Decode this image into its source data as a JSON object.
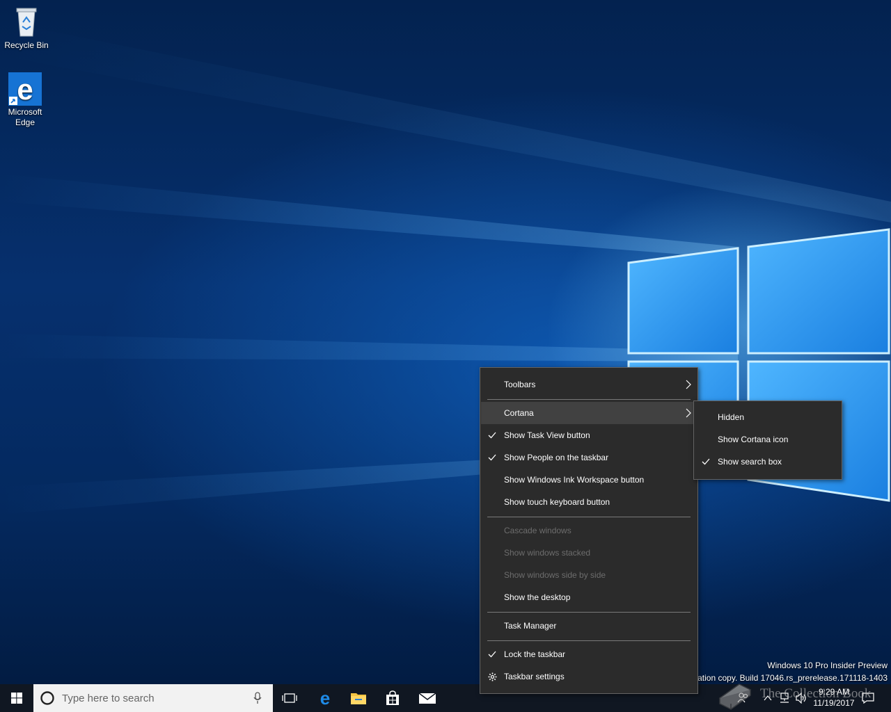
{
  "desktop": {
    "icons": [
      {
        "label": "Recycle Bin"
      },
      {
        "label_line1": "Microsoft",
        "label_line2": "Edge"
      }
    ],
    "watermark": {
      "line1": "Windows 10 Pro Insider Preview",
      "line2": "Evaluation copy. Build 17046.rs_prerelease.171118-1403"
    }
  },
  "context_menu": {
    "items": [
      {
        "label": "Toolbars",
        "submenu": true
      },
      {
        "label": "Cortana",
        "submenu": true,
        "highlighted": true
      },
      {
        "label": "Show Task View button",
        "checked": true
      },
      {
        "label": "Show People on the taskbar",
        "checked": true
      },
      {
        "label": "Show Windows Ink Workspace button"
      },
      {
        "label": "Show touch keyboard button"
      },
      {
        "label": "Cascade windows",
        "disabled": true
      },
      {
        "label": "Show windows stacked",
        "disabled": true
      },
      {
        "label": "Show windows side by side",
        "disabled": true
      },
      {
        "label": "Show the desktop"
      },
      {
        "label": "Task Manager"
      },
      {
        "label": "Lock the taskbar",
        "checked": true
      },
      {
        "label": "Taskbar settings",
        "icon": "gear-icon"
      }
    ]
  },
  "cortana_submenu": {
    "items": [
      {
        "label": "Hidden"
      },
      {
        "label": "Show Cortana icon"
      },
      {
        "label": "Show search box",
        "checked": true
      }
    ]
  },
  "taskbar": {
    "search_placeholder": "Type here to search",
    "clock_time": "9:29 AM",
    "clock_date": "11/19/2017",
    "overlay_text": "The Collection Book"
  },
  "colors": {
    "menu_bg": "#2b2b2b",
    "menu_highlight": "#414141",
    "taskbar_bg": "#101722",
    "accent": "#0078d7"
  }
}
